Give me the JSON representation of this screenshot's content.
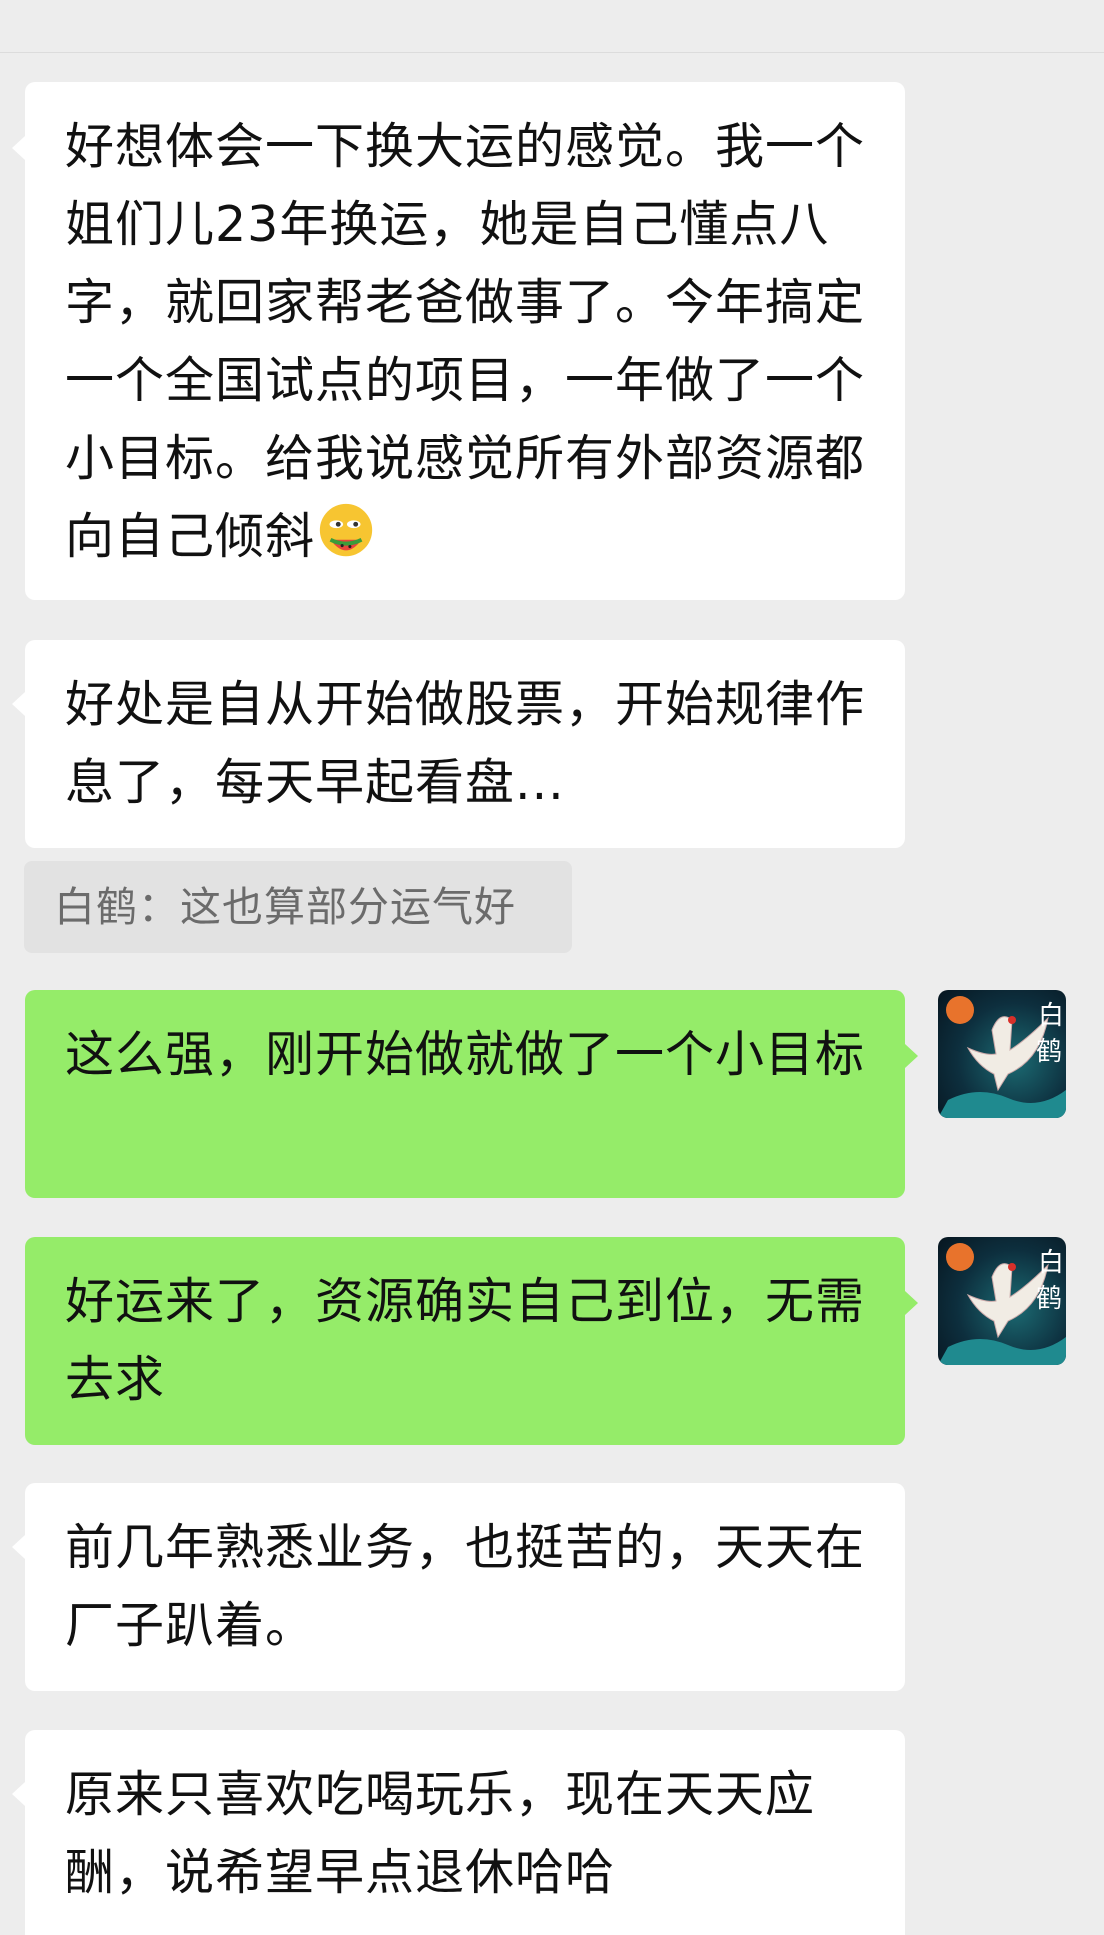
{
  "messages": [
    {
      "side": "in",
      "text": "好想体会一下换大运的感觉。我一个姐们儿23年换运，她是自己懂点八字，就回家帮老爸做事了。今年搞定一个全国试点的项目，一年做了一个小目标。给我说感觉所有外部资源都向自己倾斜"
    },
    {
      "side": "in",
      "text": "好处是自从开始做股票，开始规律作息了，每天早起看盘..."
    },
    {
      "side": "out",
      "text": "这么强，刚开始做就做了一个小目标"
    },
    {
      "side": "out",
      "text": "好运来了，资源确实自己到位，无需去求"
    },
    {
      "side": "in",
      "text": "前几年熟悉业务，也挺苦的，天天在厂子趴着。"
    },
    {
      "side": "in",
      "text": "原来只喜欢吃喝玩乐，现在天天应酬，说希望早点退休哈哈"
    }
  ],
  "quote": {
    "text": "白鹤：这也算部分运气好"
  },
  "avatar": {
    "label": "白鹤",
    "icon": "crane-avatar"
  },
  "emoji": {
    "icon": "face-with-watermelon-emoji"
  },
  "colors": {
    "background": "#ededed",
    "incoming": "#ffffff",
    "outgoing": "#95ec69"
  }
}
